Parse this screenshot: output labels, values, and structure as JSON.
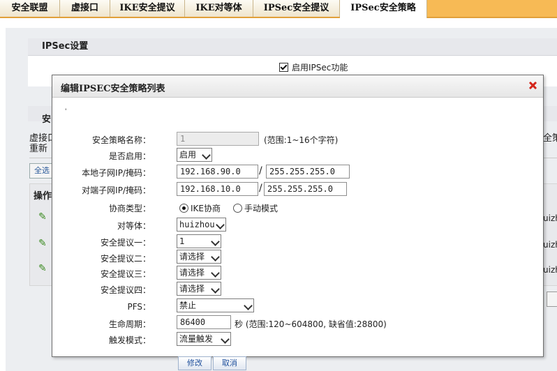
{
  "tabs": [
    {
      "label": "安全联盟",
      "active": false
    },
    {
      "label": "虚接口",
      "active": false
    },
    {
      "label": "IKE安全提议",
      "active": false
    },
    {
      "label": "IKE对等体",
      "active": false
    },
    {
      "label": "IPSec安全提议",
      "active": false
    },
    {
      "label": "IPSec安全策略",
      "active": true
    }
  ],
  "background": {
    "panel_title": "IPSec设置",
    "enable_label": "启用IPSec功能",
    "enable_checked": true,
    "frag_an": "安",
    "frag_xujie": "虚接口",
    "frag_chongxin": "重新",
    "frag_ce": "全策",
    "frag_quan": "全选",
    "frag_cao": "操作",
    "row_cells": [
      "uizh",
      "uizh",
      "uizh"
    ]
  },
  "dialog": {
    "title": "编辑IPSEC安全策略列表",
    "tick": "'",
    "labels": {
      "policy_name": "安全策略名称：",
      "enabled": "是否启用：",
      "local_subnet": "本地子网IP/掩码：",
      "remote_subnet": "对端子网IP/掩码：",
      "negotiation": "协商类型：",
      "peer": "对等体：",
      "proposal1": "安全提议一：",
      "proposal2": "安全提议二：",
      "proposal3": "安全提议三：",
      "proposal4": "安全提议四：",
      "pfs": "PFS：",
      "lifetime": "生命周期：",
      "trigger": "触发模式："
    },
    "values": {
      "policy_name": "1",
      "policy_name_hint": "(范围:1~16个字符)",
      "enabled": "启用",
      "local_ip": "192.168.90.0",
      "local_mask": "255.255.255.0",
      "remote_ip": "192.168.10.0",
      "remote_mask": "255.255.255.0",
      "slash": "/",
      "neg_ike": "IKE协商",
      "neg_manual": "手动模式",
      "neg_selected": "IKE协商",
      "peer": "huizhou",
      "proposal1": "1",
      "proposal2": "请选择",
      "proposal3": "请选择",
      "proposal4": "请选择",
      "pfs": "禁止",
      "lifetime": "86400",
      "lifetime_hint": "秒 (范围:120~604800, 缺省值:28800)",
      "trigger": "流量触发"
    },
    "buttons": {
      "modify": "修改",
      "cancel": "取消"
    }
  },
  "colors": {
    "tabbar": "#f7ba55",
    "close": "#d4261b",
    "button_text": "#1e4f9c"
  }
}
